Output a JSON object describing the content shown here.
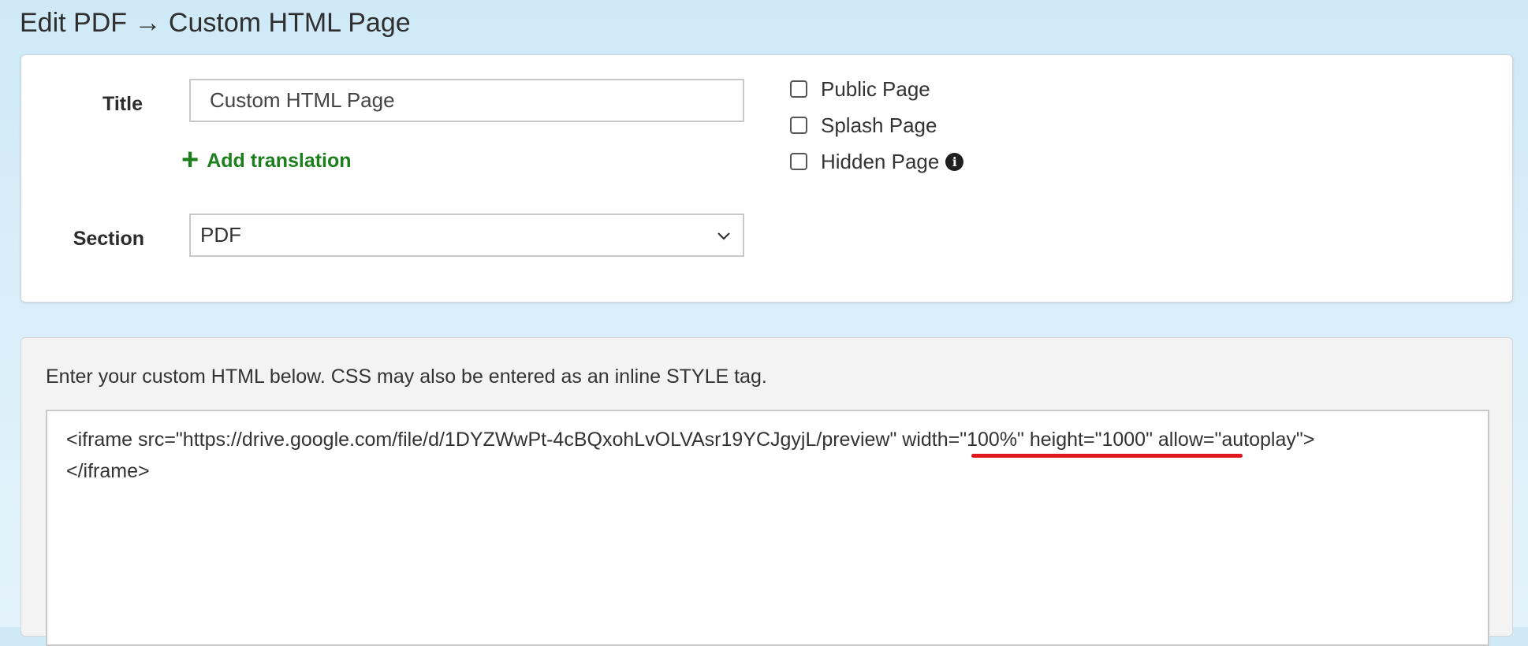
{
  "page": {
    "title": "Edit PDF → Custom HTML Page"
  },
  "form": {
    "title_label": "Title",
    "title_value": "Custom HTML Page",
    "add_translation_label": "Add translation",
    "section_label": "Section",
    "section_value": "PDF",
    "checkboxes": [
      {
        "label": "Public Page",
        "checked": false
      },
      {
        "label": "Splash Page",
        "checked": false
      },
      {
        "label": "Hidden Page",
        "checked": false
      }
    ]
  },
  "html_editor": {
    "description": "Enter your custom HTML below. CSS may also be entered as an inline STYLE tag.",
    "content": "<iframe src=\"https://drive.google.com/file/d/1DYZWwPt-4cBQxohLvOLVAsr19YCJgyjL/preview\" width=\"100%\" height=\"1000\" allow=\"autoplay\">\n</iframe>"
  },
  "colors": {
    "accent_green": "#1b7f1b",
    "highlight_red": "#e0161f"
  }
}
